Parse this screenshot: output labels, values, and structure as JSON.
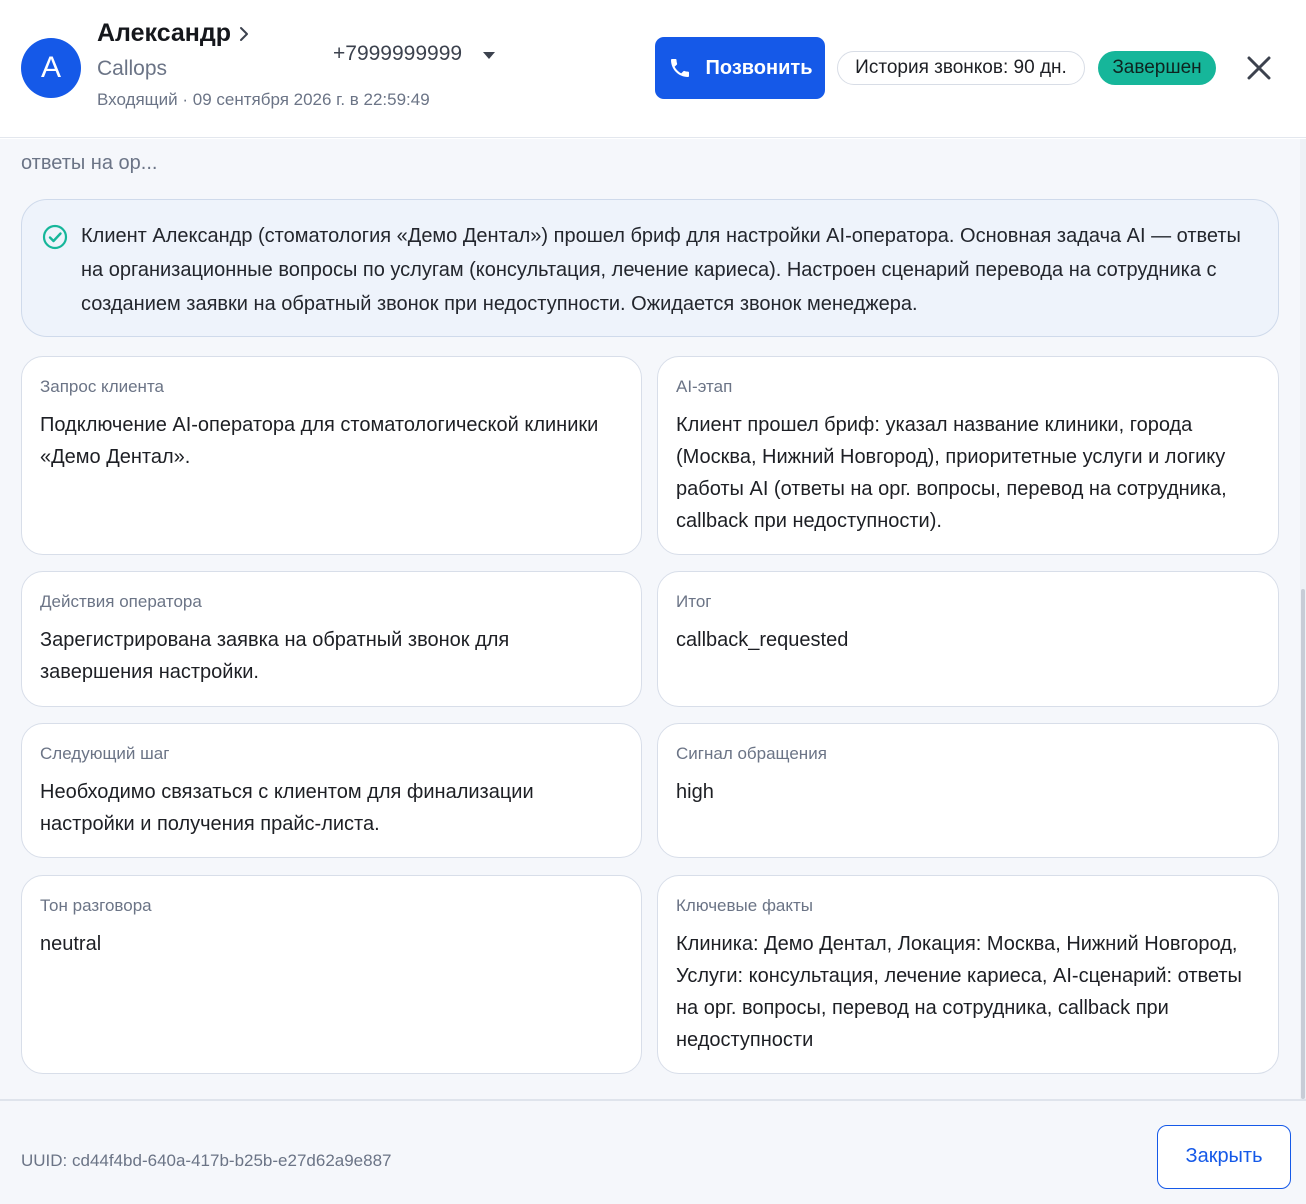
{
  "header": {
    "avatar_letter": "A",
    "contact_name": "Александр",
    "company": "Callops",
    "call_meta": "Входящий · 09 сентября 2026 г. в 22:59:49",
    "phone": "+7999999999",
    "call_button_label": "Позвонить",
    "history_label": "История звонков: 90 дн.",
    "status_label": "Завершен"
  },
  "content": {
    "truncated_text": "ответы на ор...",
    "summary": "Клиент Александр (стоматология «Демо Дентал») прошел бриф для настройки AI-оператора. Основная задача AI — ответы на организационные вопросы по услугам (консультация, лечение кариеса). Настроен сценарий перевода на сотрудника с созданием заявки на обратный звонок при недоступности. Ожидается звонок менеджера.",
    "cards": [
      {
        "label": "Запрос клиента",
        "value": "Подключение AI-оператора для стоматологической клиники «Демо Дентал»."
      },
      {
        "label": "AI-этап",
        "value": "Клиент прошел бриф: указал название клиники, города (Москва, Нижний Новгород), приоритетные услуги и логику работы AI (ответы на орг. вопросы, перевод на сотрудника, callback при недоступности)."
      },
      {
        "label": "Действия оператора",
        "value": "Зарегистрирована заявка на обратный звонок для завершения настройки."
      },
      {
        "label": "Итог",
        "value": "callback_requested"
      },
      {
        "label": "Следующий шаг",
        "value": "Необходимо связаться с клиентом для финализации настройки и получения прайс-листа."
      },
      {
        "label": "Сигнал обращения",
        "value": "high"
      },
      {
        "label": "Тон разговора",
        "value": "neutral"
      },
      {
        "label": "Ключевые факты",
        "value": "Клиника: Демо Дентал, Локация: Москва, Нижний Новгород, Услуги: консультация, лечение кариеса, AI-сценарий: ответы на орг. вопросы, перевод на сотрудника, callback при недоступности"
      }
    ]
  },
  "footer": {
    "uuid": "UUID: cd44f4bd-640a-417b-b25b-e27d62a9e887",
    "close_label": "Закрыть"
  },
  "icons": {
    "chevron": "chevron-right-icon",
    "caret": "caret-down-icon",
    "phone": "phone-icon",
    "close": "close-icon",
    "check": "check-circle-icon"
  },
  "colors": {
    "accent": "#1559e8",
    "status": "#16b69a",
    "check": "#16b69a",
    "muted_text": "#6b7486"
  }
}
